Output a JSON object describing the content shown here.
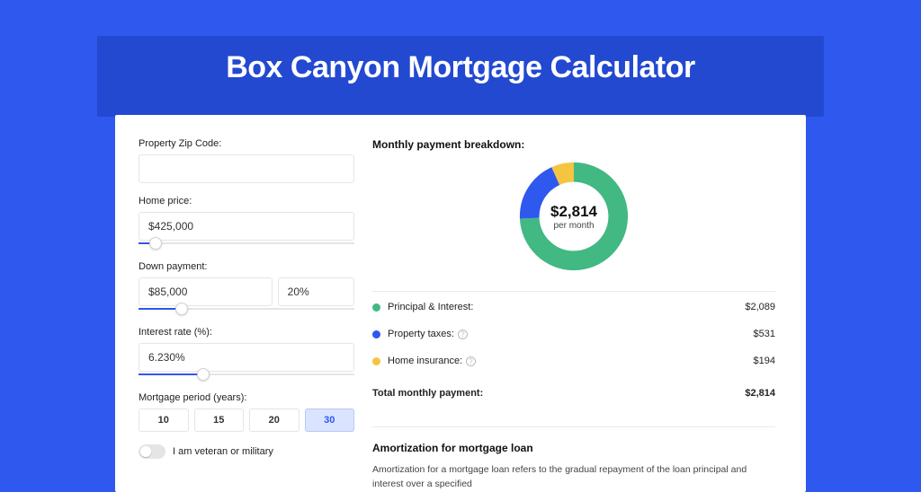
{
  "title": "Box Canyon Mortgage Calculator",
  "left": {
    "zip_label": "Property Zip Code:",
    "zip_value": "",
    "homeprice_label": "Home price:",
    "homeprice_value": "$425,000",
    "downpayment_label": "Down payment:",
    "downpayment_value": "$85,000",
    "downpayment_pct": "20%",
    "interest_label": "Interest rate (%):",
    "interest_value": "6.230%",
    "period_label": "Mortgage period (years):",
    "period_options": [
      "10",
      "15",
      "20",
      "30"
    ],
    "period_selected": "30",
    "veteran_label": "I am veteran or military",
    "sliders": {
      "homeprice_pct": 8,
      "downpayment_pct": 20,
      "interest_pct": 30
    }
  },
  "right": {
    "breakdown_title": "Monthly payment breakdown:",
    "donut_amount": "$2,814",
    "donut_sub": "per month",
    "legend": [
      {
        "color": "g",
        "label": "Principal & Interest:",
        "info": false,
        "value": "$2,089"
      },
      {
        "color": "b",
        "label": "Property taxes:",
        "info": true,
        "value": "$531"
      },
      {
        "color": "y",
        "label": "Home insurance:",
        "info": true,
        "value": "$194"
      }
    ],
    "total_label": "Total monthly payment:",
    "total_value": "$2,814",
    "amort_title": "Amortization for mortgage loan",
    "amort_body": "Amortization for a mortgage loan refers to the gradual repayment of the loan principal and interest over a specified"
  },
  "chart_data": {
    "type": "pie",
    "title": "Monthly payment breakdown",
    "series": [
      {
        "name": "Principal & Interest",
        "value": 2089,
        "color": "#42b883"
      },
      {
        "name": "Property taxes",
        "value": 531,
        "color": "#2f58ee"
      },
      {
        "name": "Home insurance",
        "value": 194,
        "color": "#f5c542"
      }
    ],
    "total": 2814,
    "center_label": "$2,814 per month"
  }
}
